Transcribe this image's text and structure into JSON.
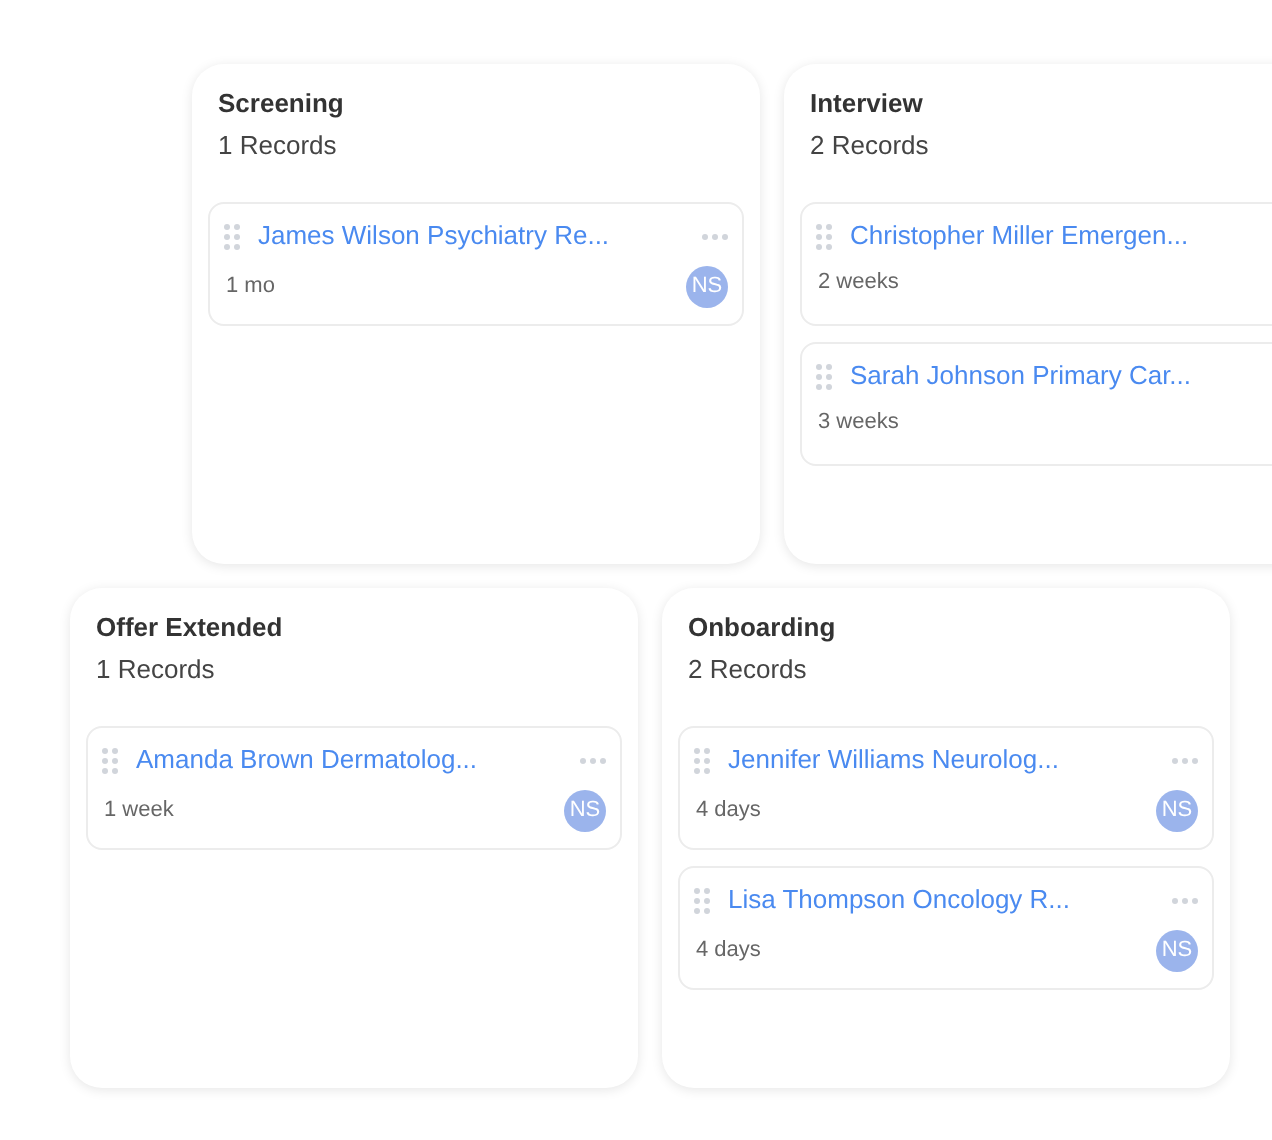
{
  "rows": [
    {
      "columns": [
        {
          "title": "Screening",
          "count": "1 Records",
          "cards": [
            {
              "title": "James Wilson Psychiatry Re...",
              "age": "1 mo",
              "menu": true,
              "avatar": "NS"
            }
          ]
        },
        {
          "title": "Interview",
          "count": "2 Records",
          "cards": [
            {
              "title": "Christopher Miller Emergen...",
              "age": "2 weeks",
              "menu": false
            },
            {
              "title": "Sarah Johnson Primary Car...",
              "age": "3 weeks",
              "menu": false
            }
          ]
        }
      ]
    },
    {
      "columns": [
        {
          "title": "Offer Extended",
          "count": "1 Records",
          "cards": [
            {
              "title": "Amanda Brown Dermatolog...",
              "age": "1 week",
              "menu": true,
              "avatar": "NS"
            }
          ]
        },
        {
          "title": "Onboarding",
          "count": "2 Records",
          "cards": [
            {
              "title": "Jennifer Williams Neurolog...",
              "age": "4 days",
              "menu": true,
              "avatar": "NS"
            },
            {
              "title": "Lisa Thompson Oncology R...",
              "age": "4 days",
              "menu": true,
              "avatar": "NS"
            }
          ]
        }
      ]
    }
  ]
}
